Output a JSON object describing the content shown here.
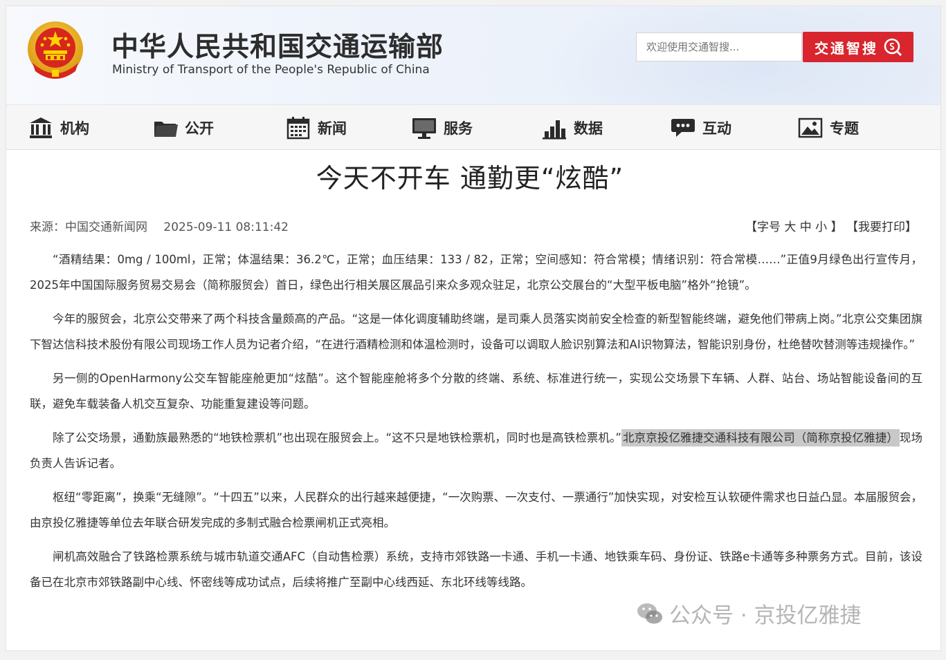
{
  "header": {
    "title_cn": "中华人民共和国交通运输部",
    "title_en": "Ministry of Transport of the People's Republic of China",
    "search_placeholder": "欢迎使用交通智搜...",
    "search_button": "交通智搜"
  },
  "nav": [
    {
      "label": "机构",
      "icon": "building-icon"
    },
    {
      "label": "公开",
      "icon": "folder-icon"
    },
    {
      "label": "新闻",
      "icon": "calendar-icon"
    },
    {
      "label": "服务",
      "icon": "monitor-icon"
    },
    {
      "label": "数据",
      "icon": "bar-chart-icon"
    },
    {
      "label": "互动",
      "icon": "chat-bubble-icon"
    },
    {
      "label": "专题",
      "icon": "picture-icon"
    }
  ],
  "article": {
    "title": "今天不开车 通勤更“炫酷”",
    "source": "来源：中国交通新闻网",
    "datetime": "2025-09-11 08:11:42",
    "font_size_tool": "【字号 大 中 小 】",
    "print_tool": "【我要打印】",
    "paragraphs": {
      "p1": "“酒精结果：0mg / 100ml，正常；体温结果：36.2℃，正常；血压结果：133 / 82，正常；空间感知：符合常模；情绪识别：符合常模……”正值9月绿色出行宣传月，2025年中国国际服务贸易交易会（简称服贸会）首日，绿色出行相关展区展品引来众多观众驻足，北京公交展台的“大型平板电脑”格外“抢镜”。",
      "p2": "今年的服贸会，北京公交带来了两个科技含量颇高的产品。“这是一体化调度辅助终端，是司乘人员落实岗前安全检查的新型智能终端，避免他们带病上岗。”北京公交集团旗下智达信科技术股份有限公司现场工作人员为记者介绍，“在进行酒精检测和体温检测时，设备可以调取人脸识别算法和AI识物算法，智能识别身份，杜绝替吹替测等违规操作。”",
      "p3": "另一侧的OpenHarmony公交车智能座舱更加“炫酷”。这个智能座舱将多个分散的终端、系统、标准进行统一，实现公交场景下车辆、人群、站台、场站智能设备间的互联，避免车载装备人机交互复杂、功能重复建设等问题。",
      "p4a": "除了公交场景，通勤族最熟悉的“地铁检票机”也出现在服贸会上。“这不只是地铁检票机，同时也是高铁检票机。”",
      "p4b": "北京京投亿雅捷交通科技有限公司（简称京投亿雅捷）",
      "p4c": "现场负责人告诉记者。",
      "p5": "枢纽“零距离”，换乘“无缝隙”。“十四五”以来，人民群众的出行越来越便捷，“一次购票、一次支付、一票通行”加快实现，对安检互认软硬件需求也日益凸显。本届服贸会，由京投亿雅捷等单位去年联合研发完成的多制式融合检票闸机正式亮相。",
      "p6": "闸机高效融合了铁路检票系统与城市轨道交通AFC（自动售检票）系统，支持市郊铁路一卡通、手机一卡通、地铁乘车码、身份证、铁路e卡通等多种票务方式。目前，该设备已在北京市郊铁路副中心线、怀密线等成功试点，后续将推广至副中心线西延、东北环线等线路。"
    }
  },
  "watermark": "公众号 · 京投亿雅捷",
  "colors": {
    "accent_red": "#d8252e",
    "highlight": "#c8c8c8"
  }
}
